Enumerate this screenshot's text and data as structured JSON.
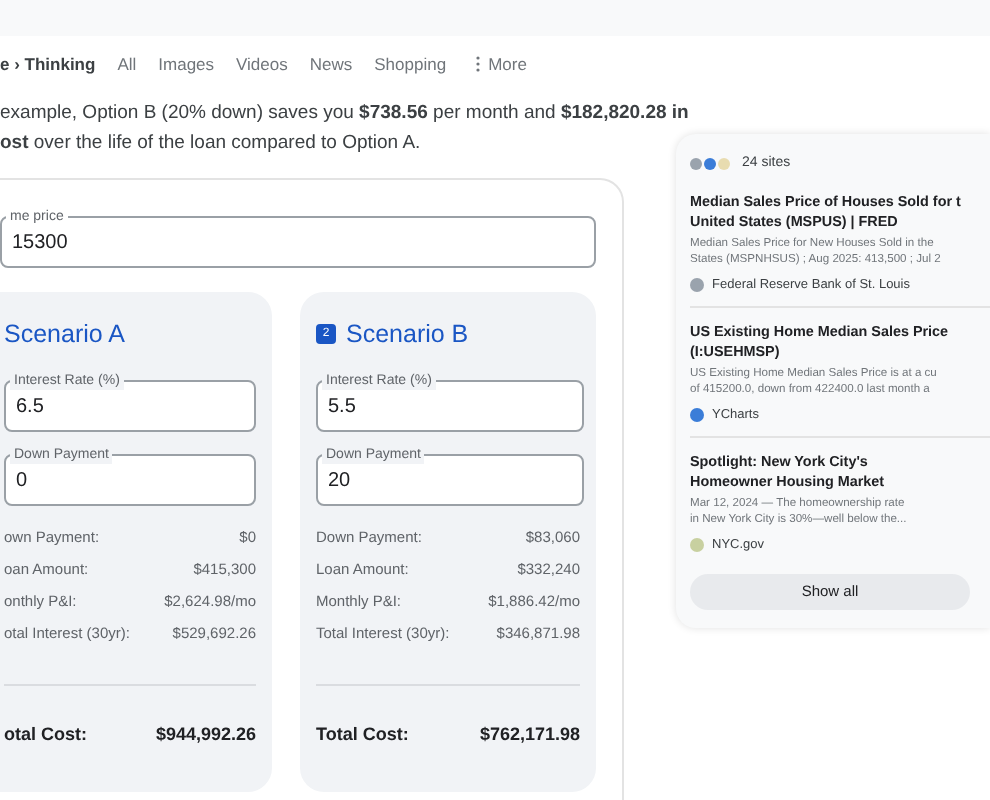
{
  "nav": {
    "crumb": "e › Thinking",
    "tabs": [
      {
        "label": "All",
        "selected": false
      },
      {
        "label": "Images",
        "selected": false
      },
      {
        "label": "Videos",
        "selected": false
      },
      {
        "label": "News",
        "selected": false
      },
      {
        "label": "Shopping",
        "selected": false
      }
    ],
    "more": "More"
  },
  "summary_lines": [
    "example, Option B (20% down) saves you **$738.56** per month and **$182,820.28 in**",
    "**ost** over the life of the loan compared to Option A."
  ],
  "home_price": {
    "label": "me price",
    "value": "15300"
  },
  "scenarios": [
    {
      "title": "Scenario A",
      "fields": [
        {
          "label": "Interest Rate (%)",
          "value": "6.5"
        },
        {
          "label": "Down Payment",
          "value": "0"
        }
      ],
      "rows": [
        {
          "label": "own Payment:",
          "value": "$0"
        },
        {
          "label": "oan Amount:",
          "value": "$415,300"
        },
        {
          "label": "onthly P&I:",
          "value": "$2,624.98/mo"
        },
        {
          "label": "otal Interest (30yr):",
          "value": "$529,692.26"
        }
      ],
      "total": {
        "label": "otal Cost:",
        "value": "$944,992.26"
      }
    },
    {
      "badge": "2",
      "title": "Scenario B",
      "fields": [
        {
          "label": "Interest Rate (%)",
          "value": "5.5"
        },
        {
          "label": "Down Payment",
          "value": "20"
        }
      ],
      "rows": [
        {
          "label": "Down Payment:",
          "value": "$83,060"
        },
        {
          "label": "Loan Amount:",
          "value": "$332,240"
        },
        {
          "label": "Monthly P&I:",
          "value": "$1,886.42/mo"
        },
        {
          "label": "Total Interest (30yr):",
          "value": "$346,871.98"
        }
      ],
      "total": {
        "label": "Total Cost:",
        "value": "$762,171.98"
      }
    }
  ],
  "sources": {
    "count": "24 sites",
    "items": [
      {
        "title_lines": [
          "Median Sales Price of Houses Sold for t",
          "United States (MSPUS) | FRED"
        ],
        "snippet_lines": [
          "Median Sales Price for New Houses Sold in the",
          "States (MSPNHSUS) ; Aug 2025: 413,500 ; Jul 2"
        ],
        "site": "Federal Reserve Bank of St. Louis",
        "color": "#9aa3ad"
      },
      {
        "title_lines": [
          "US Existing Home Median Sales Price",
          "(I:USEHMSP)"
        ],
        "snippet_lines": [
          "US Existing Home Median Sales Price is at a cu",
          "of 415200.0, down from 422400.0 last month a"
        ],
        "site": "YCharts",
        "color": "#3b7dd8"
      },
      {
        "title_lines": [
          "Spotlight: New York City's",
          "Homeowner Housing Market"
        ],
        "snippet_lines": [
          "Mar 12, 2024 — The homeownership rate",
          "in New York City is 30%—well below the..."
        ],
        "site": "NYC.gov",
        "color": "#c8d0a0"
      }
    ],
    "show_all": "Show all"
  }
}
